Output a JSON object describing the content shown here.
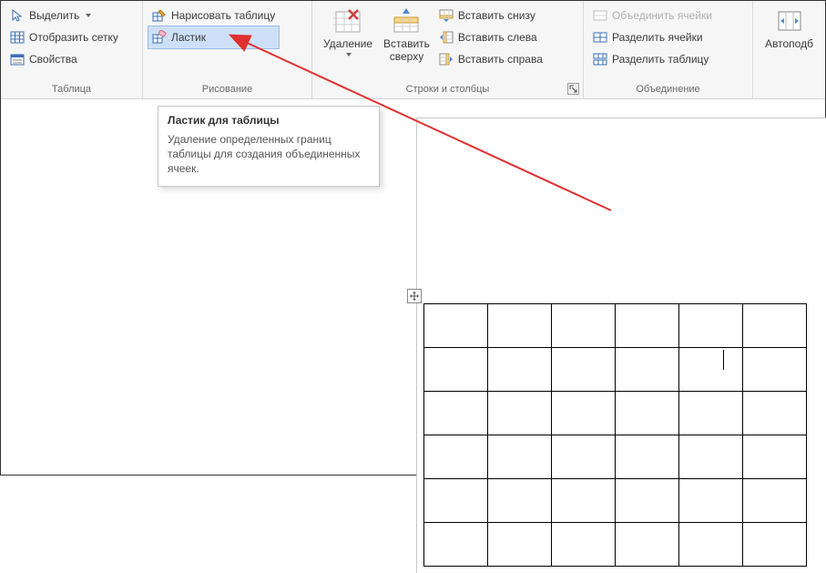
{
  "ribbon": {
    "table_group": {
      "label": "Таблица",
      "select": "Выделить",
      "gridlines": "Отобразить сетку",
      "properties": "Свойства"
    },
    "draw_group": {
      "label": "Рисование",
      "draw_table": "Нарисовать таблицу",
      "eraser": "Ластик"
    },
    "rowscols_group": {
      "label": "Строки и столбцы",
      "delete": "Удаление",
      "insert_above_l1": "Вставить",
      "insert_above_l2": "сверху",
      "insert_below": "Вставить снизу",
      "insert_left": "Вставить слева",
      "insert_right": "Вставить справа"
    },
    "merge_group": {
      "label": "Объединение",
      "merge_cells": "Объединить ячейки",
      "split_cells": "Разделить ячейки",
      "split_table": "Разделить таблицу"
    },
    "autofit_group": {
      "autofit": "Автоподб"
    }
  },
  "tooltip": {
    "title": "Ластик для таблицы",
    "body": "Удаление определенных границ таблицы для создания объединенных ячеек."
  },
  "table": {
    "rows": 6,
    "cols": 6
  }
}
